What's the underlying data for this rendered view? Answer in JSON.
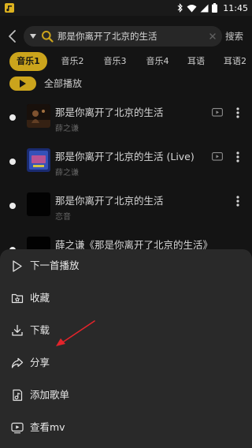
{
  "status_bar": {
    "time": "11:45"
  },
  "search": {
    "query": "那是你离开了北京的生活",
    "button_label": "搜索"
  },
  "tabs": [
    {
      "label": "音乐1",
      "active": true
    },
    {
      "label": "音乐2",
      "active": false
    },
    {
      "label": "音乐3",
      "active": false
    },
    {
      "label": "音乐4",
      "active": false
    },
    {
      "label": "耳语",
      "active": false
    },
    {
      "label": "耳语2",
      "active": false
    }
  ],
  "play_all": {
    "label": "全部播放"
  },
  "songs": [
    {
      "title": "那是你离开了北京的生活",
      "artist": "薛之谦",
      "has_mv": true
    },
    {
      "title": "那是你离开了北京的生活 (Live)",
      "artist": "薛之谦",
      "has_mv": true
    },
    {
      "title": "那是你离开了北京的生活",
      "artist": "恋音",
      "has_mv": false
    },
    {
      "title": "薛之谦《那是你离开了北京的生活》",
      "artist": "",
      "has_mv": false
    }
  ],
  "action_sheet": {
    "items": [
      {
        "label": "下一首播放",
        "icon": "play-next-icon"
      },
      {
        "label": "收藏",
        "icon": "favorite-folder-icon"
      },
      {
        "label": "下载",
        "icon": "download-icon"
      },
      {
        "label": "分享",
        "icon": "share-icon"
      },
      {
        "label": "添加歌单",
        "icon": "add-playlist-icon"
      },
      {
        "label": "查看mv",
        "icon": "watch-mv-icon"
      }
    ]
  },
  "colors": {
    "accent": "#ddb21f",
    "background": "#161616",
    "sheet": "#292929",
    "annotation": "#e3242b"
  }
}
